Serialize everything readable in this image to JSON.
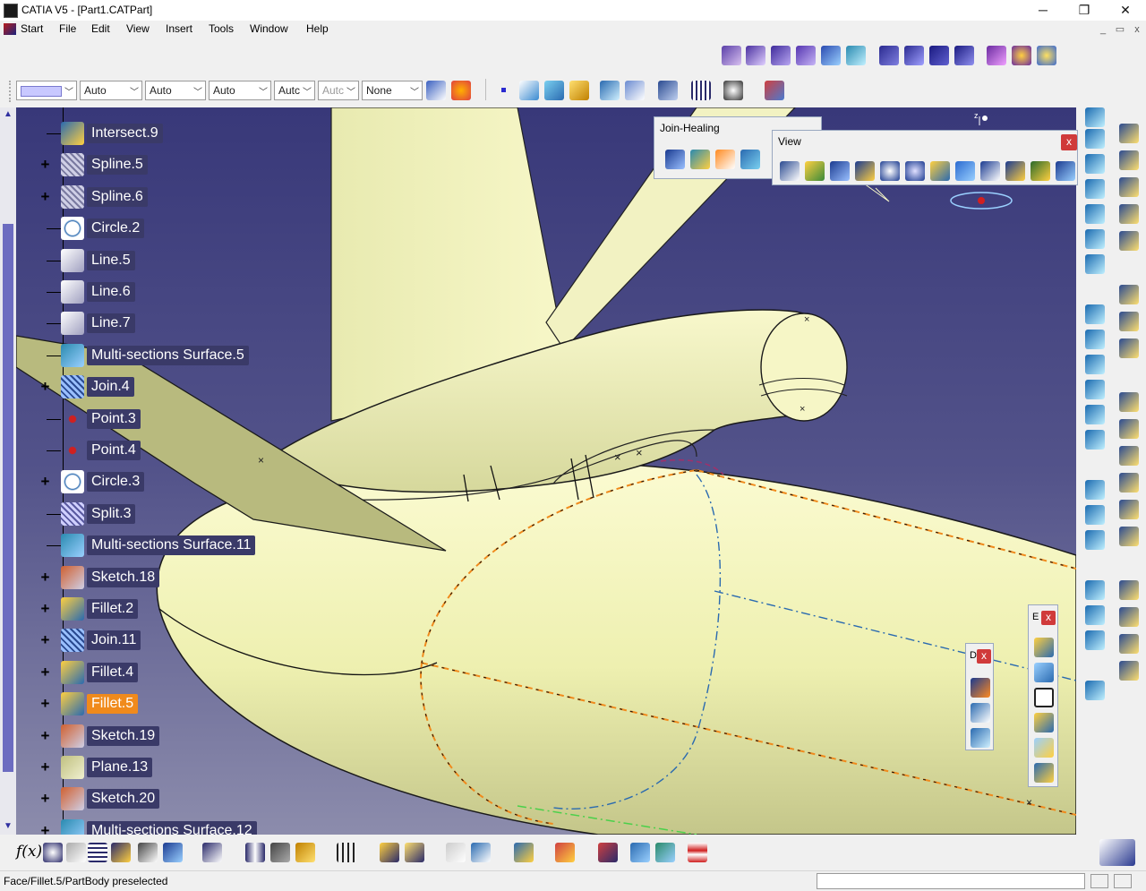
{
  "window": {
    "title": "CATIA V5 - [Part1.CATPart]",
    "minimize": "─",
    "maximize": "❐",
    "close": "✕",
    "mdi_minimize": "_",
    "mdi_restore": "▭",
    "mdi_close": "x"
  },
  "menu": [
    {
      "label": "Start"
    },
    {
      "label": "File"
    },
    {
      "label": "Edit"
    },
    {
      "label": "View"
    },
    {
      "label": "Insert"
    },
    {
      "label": "Tools"
    },
    {
      "label": "Window"
    },
    {
      "label": "Help"
    }
  ],
  "graphic_properties": {
    "color": "",
    "transparency": "Auto",
    "linetype": "Auto",
    "thickness": "Auto",
    "point": "Autc",
    "layer": "Autc",
    "layer_name": "None"
  },
  "tree": {
    "items": [
      {
        "label": "Intersect.9",
        "expand": false,
        "icon": "intersect-icon"
      },
      {
        "label": "Spline.5",
        "expand": true,
        "icon": "spline-icon"
      },
      {
        "label": "Spline.6",
        "expand": true,
        "icon": "spline-icon"
      },
      {
        "label": "Circle.2",
        "expand": false,
        "icon": "circle-icon"
      },
      {
        "label": "Line.5",
        "expand": false,
        "icon": "line-icon"
      },
      {
        "label": "Line.6",
        "expand": false,
        "icon": "line-icon"
      },
      {
        "label": "Line.7",
        "expand": false,
        "icon": "line-icon"
      },
      {
        "label": "Multi-sections Surface.5",
        "expand": false,
        "icon": "multi-sections-surface-icon"
      },
      {
        "label": "Join.4",
        "expand": true,
        "icon": "join-icon"
      },
      {
        "label": "Point.3",
        "expand": false,
        "icon": "point-icon"
      },
      {
        "label": "Point.4",
        "expand": false,
        "icon": "point-icon"
      },
      {
        "label": "Circle.3",
        "expand": true,
        "icon": "circle-icon"
      },
      {
        "label": "Split.3",
        "expand": false,
        "icon": "split-icon"
      },
      {
        "label": "Multi-sections Surface.11",
        "expand": false,
        "icon": "multi-sections-surface-icon"
      },
      {
        "label": "Sketch.18",
        "expand": true,
        "icon": "sketch-icon"
      },
      {
        "label": "Fillet.2",
        "expand": true,
        "icon": "fillet-icon"
      },
      {
        "label": "Join.11",
        "expand": true,
        "icon": "join-icon"
      },
      {
        "label": "Fillet.4",
        "expand": true,
        "icon": "fillet-icon"
      },
      {
        "label": "Fillet.5",
        "expand": true,
        "icon": "fillet-icon",
        "selected": true
      },
      {
        "label": "Sketch.19",
        "expand": true,
        "icon": "sketch-icon"
      },
      {
        "label": "Plane.13",
        "expand": true,
        "icon": "plane-icon"
      },
      {
        "label": "Sketch.20",
        "expand": true,
        "icon": "sketch-icon"
      },
      {
        "label": "Multi-sections Surface.12",
        "expand": true,
        "icon": "multi-sections-surface-icon"
      }
    ]
  },
  "floating_toolbars": {
    "join_healing": {
      "title": "Join-Healing"
    },
    "view": {
      "title": "View"
    },
    "small_b": {
      "title": "E"
    },
    "small_d": {
      "title": "D"
    }
  },
  "status": {
    "message": "Face/Fillet.5/PartBody preselected"
  },
  "compass": {
    "axis_label": "z"
  },
  "colors": {
    "viewport_top": "#383879",
    "viewport_bottom": "#8c8cac",
    "model_surface": "#f4f4bc",
    "selection_highlight": "#f08a1c",
    "tree_label_bg": "#3a3a68"
  }
}
